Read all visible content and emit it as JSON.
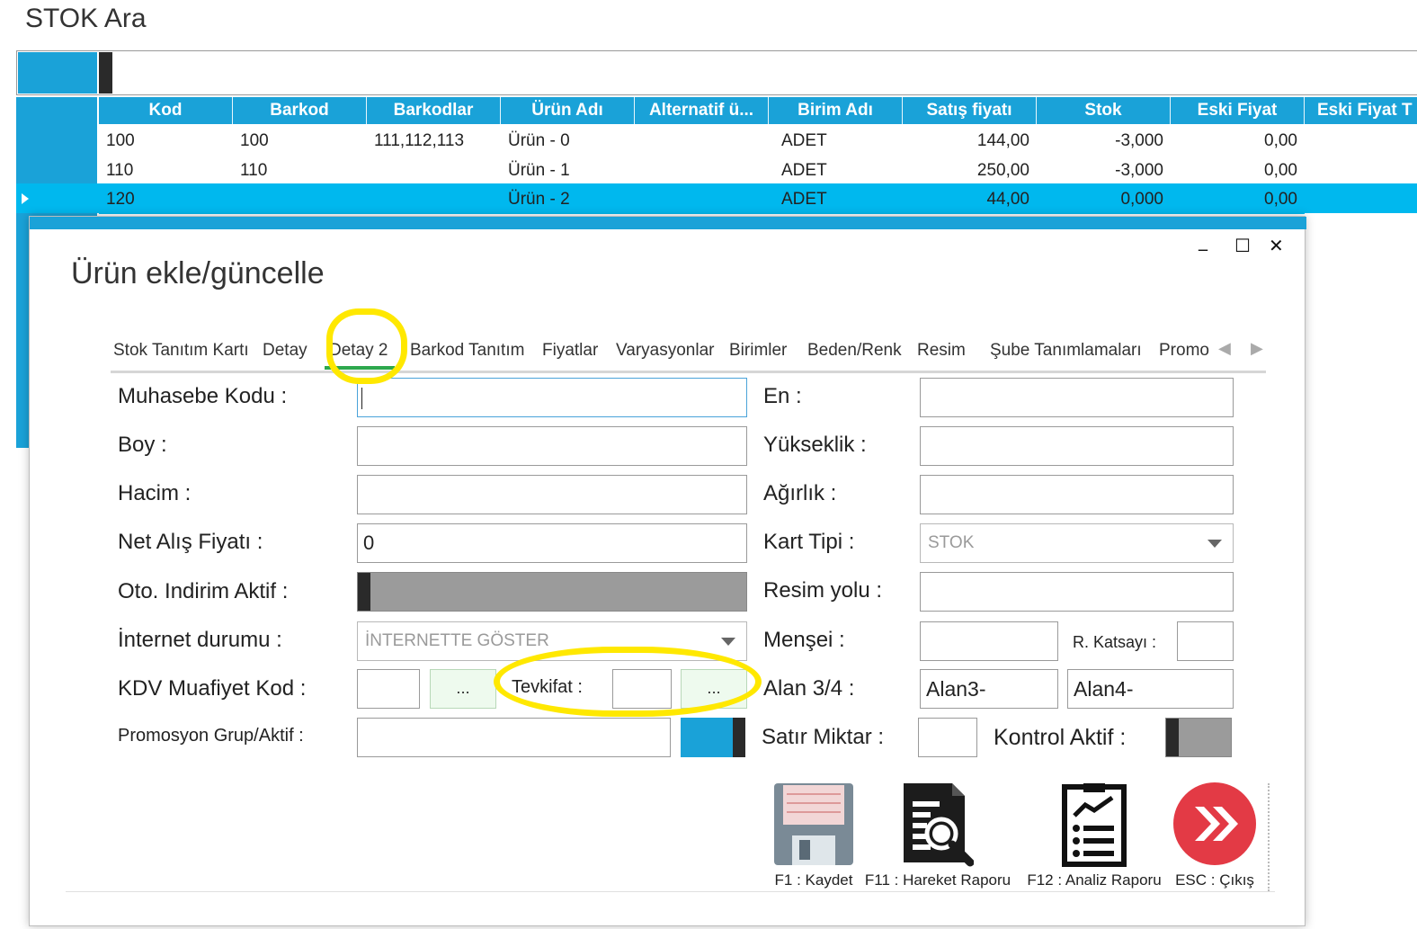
{
  "background": {
    "title": "STOK Ara",
    "grid": {
      "columns": [
        "Kod",
        "Barkod",
        "Barkodlar",
        "Ürün Adı",
        "Alternatif ü...",
        "Birim Adı",
        "Satış fiyatı",
        "Stok",
        "Eski Fiyat",
        "Eski Fiyat T"
      ],
      "rows": [
        {
          "kod": "100",
          "barkod": "100",
          "barkodlar": "111,112,113",
          "urun_adi": "Ürün - 0",
          "alternatif": "",
          "birim": "ADET",
          "satis": "144,00",
          "stok": "-3,000",
          "eski": "0,00"
        },
        {
          "kod": "110",
          "barkod": "110",
          "barkodlar": "",
          "urun_adi": "Ürün - 1",
          "alternatif": "",
          "birim": "ADET",
          "satis": "250,00",
          "stok": "-3,000",
          "eski": "0,00"
        },
        {
          "kod": "120",
          "barkod": "",
          "barkodlar": "",
          "urun_adi": "Ürün - 2",
          "alternatif": "",
          "birim": "ADET",
          "satis": "44,00",
          "stok": "0,000",
          "eski": "0,00"
        }
      ],
      "selected_row_index": 2
    }
  },
  "modal": {
    "title": "Ürün ekle/güncelle",
    "window_controls": {
      "minimize": "_",
      "maximize": "☐",
      "close": "✕"
    },
    "tabs": [
      {
        "label": "Stok Tanıtım Kartı",
        "active": false
      },
      {
        "label": "Detay",
        "active": false
      },
      {
        "label": "Detay 2",
        "active": true
      },
      {
        "label": "Barkod Tanıtım",
        "active": false
      },
      {
        "label": "Fiyatlar",
        "active": false
      },
      {
        "label": "Varyasyonlar",
        "active": false
      },
      {
        "label": "Birimler",
        "active": false
      },
      {
        "label": "Beden/Renk",
        "active": false
      },
      {
        "label": "Resim",
        "active": false
      },
      {
        "label": "Şube Tanımlamaları",
        "active": false
      },
      {
        "label": "Promo",
        "active": false
      }
    ],
    "tab_nav": {
      "prev": "◀",
      "next": "▶"
    },
    "form": {
      "muhasebe_kodu": {
        "label": "Muhasebe Kodu :",
        "value": ""
      },
      "boy": {
        "label": "Boy :",
        "value": ""
      },
      "hacim": {
        "label": "Hacim :",
        "value": ""
      },
      "net_alis": {
        "label": "Net Alış Fiyatı :",
        "value": "0"
      },
      "oto_indirim": {
        "label": "Oto. Indirim Aktif :",
        "on": false
      },
      "internet_durumu": {
        "label": "İnternet durumu :",
        "value": "İNTERNETTE GÖSTER"
      },
      "kdv_muafiyet": {
        "label": "KDV Muafiyet Kod :",
        "value": "",
        "button": "..."
      },
      "tevkifat": {
        "label": "Tevkifat :",
        "value": "",
        "button": "..."
      },
      "promosyon": {
        "label": "Promosyon Grup/Aktif :",
        "value": "",
        "on": true
      },
      "en": {
        "label": "En :",
        "value": ""
      },
      "yukseklik": {
        "label": "Yükseklik :",
        "value": ""
      },
      "agirlik": {
        "label": "Ağırlık :",
        "value": ""
      },
      "kart_tipi": {
        "label": "Kart Tipi :",
        "value": "STOK"
      },
      "resim_yolu": {
        "label": "Resim yolu :",
        "value": ""
      },
      "mensei": {
        "label": "Menşei :",
        "value": ""
      },
      "r_katsayi": {
        "label": "R. Katsayı :",
        "value": ""
      },
      "alan34": {
        "label": "Alan 3/4 :",
        "alan3": "Alan3-",
        "alan4": "Alan4-"
      },
      "satir_miktar": {
        "label": "Satır Miktar :",
        "value": ""
      },
      "kontrol_aktif": {
        "label": "Kontrol Aktif :",
        "on": false
      }
    },
    "actions": [
      {
        "label": "F1 : Kaydet",
        "icon": "floppy-disk-icon"
      },
      {
        "label": "F11 : Hareket Raporu",
        "icon": "document-search-icon"
      },
      {
        "label": "F12 : Analiz Raporu",
        "icon": "analysis-report-icon"
      },
      {
        "label": "ESC : Çıkış",
        "icon": "exit-icon"
      }
    ],
    "highlight_color": "#ffe800"
  }
}
